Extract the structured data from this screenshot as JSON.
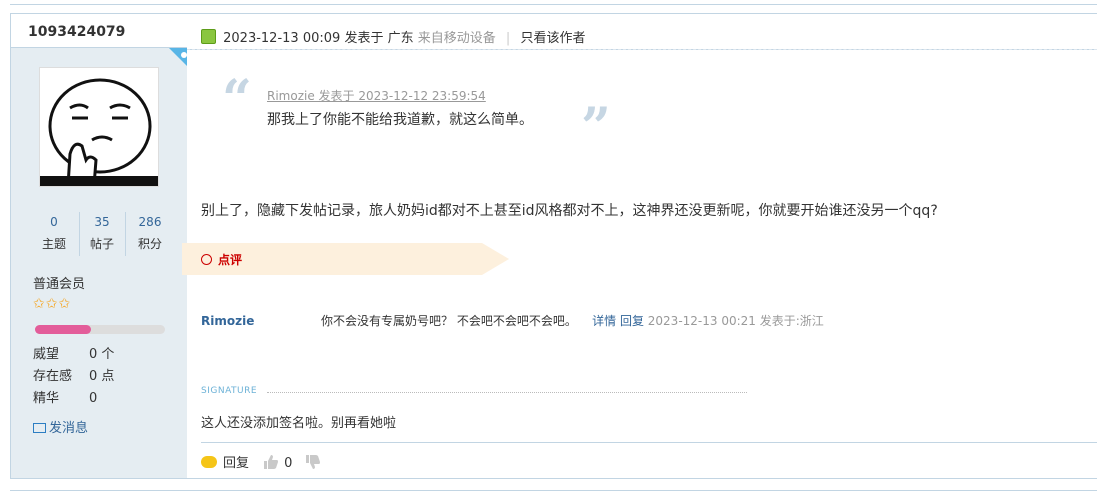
{
  "user": {
    "username": "1093424079",
    "stats": [
      {
        "value": "0",
        "label": "主题"
      },
      {
        "value": "35",
        "label": "帖子"
      },
      {
        "value": "286",
        "label": "积分"
      }
    ],
    "group": "普通会员",
    "stars": 3,
    "progress_fraction": 0.43,
    "details": [
      {
        "key": "威望",
        "value": "0 个"
      },
      {
        "key": "存在感",
        "value": "0 点"
      },
      {
        "key": "精华",
        "value": "0"
      }
    ],
    "message_label": "发消息",
    "colors": {
      "sidebar_bg": "#e5edf2",
      "progress": "#e35d9a",
      "corner": "#58b5e6"
    }
  },
  "post": {
    "datetime": "2023-12-13 00:09",
    "posted_at_label": "发表于",
    "location": "广东",
    "from_device": "来自移动设备",
    "author_only": "只看该作者",
    "quote": {
      "header": "Rimozie 发表于 2023-12-12 23:59:54",
      "text": "那我上了你能不能给我道歉，就这么简单。"
    },
    "body": "别上了，隐藏下发帖记录，旅人奶妈id都对不上甚至id风格都对不上，这神界还没更新呢，你就要开始谁还没另一个qq?",
    "dianping_label": "点评",
    "comment": {
      "user": "Rimozie",
      "text": "你不会没有专属奶号吧？ 不会吧不会吧不会吧。",
      "detail_link": "详情",
      "reply_link": "回复",
      "meta": "2023-12-13 00:21 发表于:浙江"
    },
    "signature_label": "SIGNATURE",
    "signature": "这人还没添加签名啦。别再看她啦",
    "footer": {
      "reply_label": "回复",
      "like_count": "0"
    }
  }
}
